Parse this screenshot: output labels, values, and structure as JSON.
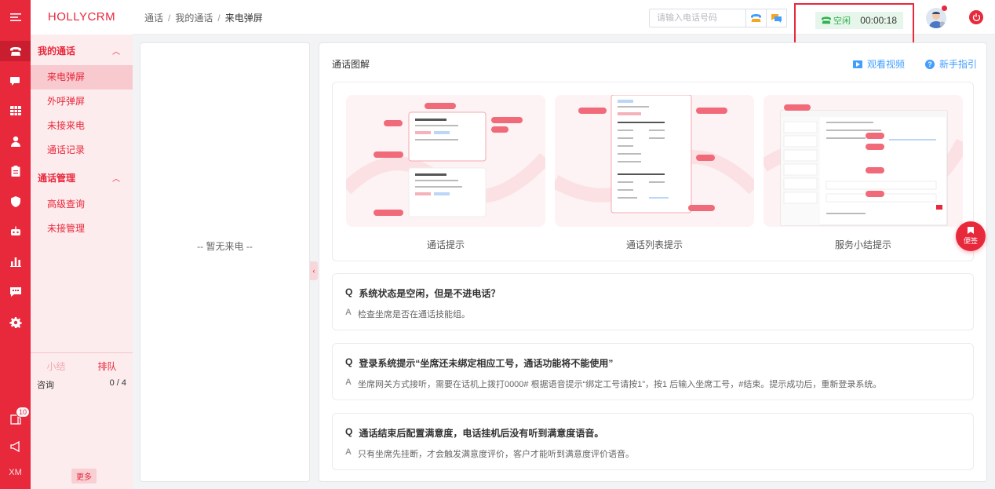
{
  "rail": {
    "footer_text": "XM",
    "notification_count": "10"
  },
  "nav": {
    "logo": "HOLLYCRM",
    "groups": [
      {
        "label": "我的通话",
        "items": [
          "来电弹屏",
          "外呼弹屏",
          "未接来电",
          "通话记录"
        ]
      },
      {
        "label": "通话管理",
        "items": [
          "高级查询",
          "未接管理"
        ]
      }
    ],
    "stats": {
      "tab_summary": "小结",
      "tab_queue": "排队",
      "row_label": "咨询",
      "row_value": "0 / 4"
    },
    "more": "更多"
  },
  "header": {
    "breadcrumb": [
      "通话",
      "我的通话",
      "来电弹屏"
    ],
    "phone_placeholder": "请输入电话号码",
    "status_label": "空闲",
    "timer": "00:00:18"
  },
  "left_panel": {
    "empty_text": "-- 暂无来电 --"
  },
  "main": {
    "title": "通话图解",
    "video_link": "观看视频",
    "guide_link": "新手指引",
    "illustrations": [
      "通话提示",
      "通话列表提示",
      "服务小结提示"
    ],
    "faq": [
      {
        "q": "系统状态是空闲，但是不进电话？",
        "a": "检查坐席是否在通话技能组。"
      },
      {
        "q": "登录系统提示“坐席还未绑定相应工号，通话功能将不能使用”",
        "a": "坐席网关方式接听，需要在话机上拨打0000# 根据语音提示“绑定工号请按1”，按1 后输入坐席工号，#结束。提示成功后，重新登录系统。"
      },
      {
        "q": "通话结束后配置满意度，电话挂机后没有听到满意度语音。",
        "a": "只有坐席先挂断，才会触发满意度评价，客户才能听到满意度评价语音。"
      }
    ],
    "q_marker": "Q",
    "a_marker": "A"
  },
  "float_button": "便签",
  "colors": {
    "brand": "#e8283b",
    "link": "#409eff",
    "idle_green": "#2bb24c"
  }
}
